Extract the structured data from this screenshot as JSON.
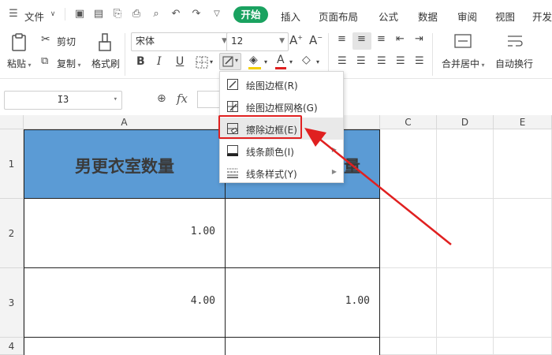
{
  "tabs": {
    "file": "文件",
    "items": [
      "开始",
      "插入",
      "页面布局",
      "公式",
      "数据",
      "审阅",
      "视图",
      "开发"
    ],
    "active_index": 0
  },
  "ribbon": {
    "paste": "粘贴",
    "cut": "剪切",
    "copy": "复制",
    "format_painter": "格式刷",
    "font_name": "宋体",
    "font_size": "12",
    "bold": "B",
    "italic": "I",
    "underline": "U",
    "merge_center": "合并居中",
    "wrap_text": "自动换行"
  },
  "formula_bar": {
    "name_box": "I3",
    "fx": "fx"
  },
  "columns": [
    "A",
    "B",
    "C",
    "D",
    "E"
  ],
  "rows": [
    "1",
    "2",
    "3",
    "4"
  ],
  "cells": {
    "a1": "男更衣室数量",
    "b1_partial": "量",
    "a2": "1.00",
    "a3": "4.00",
    "b3": "1.00"
  },
  "border_menu": {
    "items": [
      {
        "label": "绘图边框(R)",
        "icon": "draw-border-icon",
        "has_submenu": false
      },
      {
        "label": "绘图边框网格(G)",
        "icon": "draw-border-grid-icon",
        "has_submenu": false
      },
      {
        "label": "擦除边框(E)",
        "icon": "erase-border-icon",
        "has_submenu": false,
        "highlighted": true
      },
      {
        "label": "线条颜色(I)",
        "icon": "line-color-icon",
        "has_submenu": true
      },
      {
        "label": "线条样式(Y)",
        "icon": "line-style-icon",
        "has_submenu": true
      }
    ]
  },
  "colors": {
    "accent_green": "#1aa260",
    "header_fill": "#5b9bd5",
    "annotation_red": "#e02020",
    "font_color_bar": "#e02020",
    "highlight_bar": "#f5d000"
  }
}
